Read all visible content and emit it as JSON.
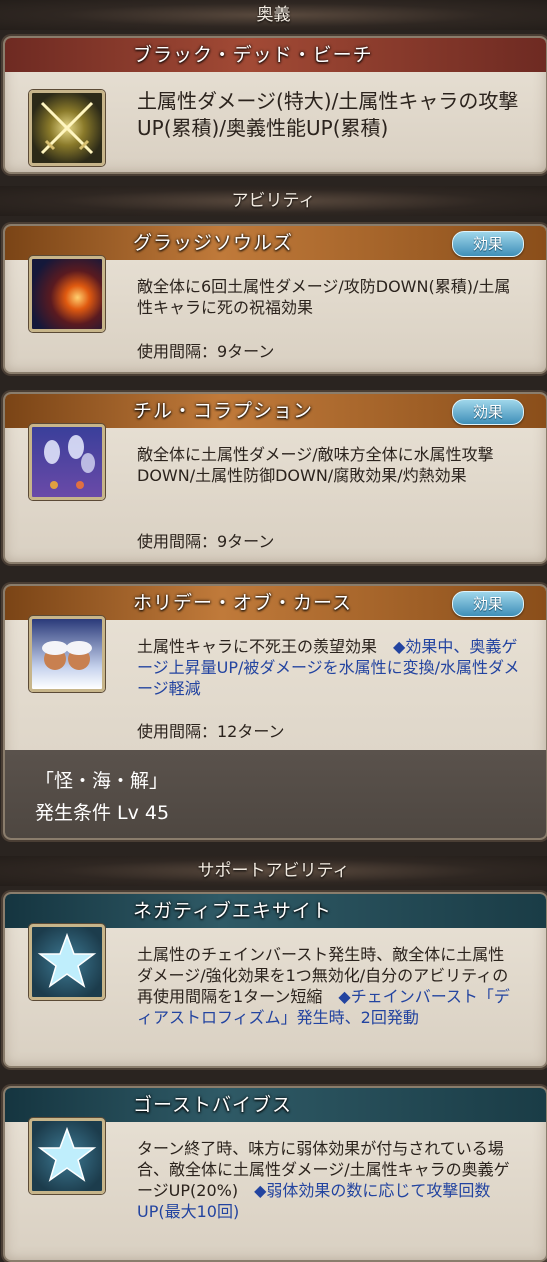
{
  "sections": {
    "ougi": "奥義",
    "ability": "アビリティ",
    "support": "サポートアビリティ"
  },
  "ougi": {
    "name": "ブラック・デッド・ビーチ",
    "desc": "土属性ダメージ(特大)/土属性キャラの攻撃UP(累積)/奥義性能UP(累積)",
    "icon": "crossed-swords-icon"
  },
  "abilities": [
    {
      "name": "グラッジソウルズ",
      "badge": "効果",
      "desc": "敵全体に6回土属性ダメージ/攻防DOWN(累積)/土属性キャラに死の祝福効果",
      "extra": "",
      "interval": "使用間隔：9ターン",
      "icon": "fireball-icon"
    },
    {
      "name": "チル・コラプション",
      "badge": "効果",
      "desc": "敵全体に土属性ダメージ/敵味方全体に水属性攻撃DOWN/土属性防御DOWN/腐敗効果/灼熱効果",
      "extra": "",
      "interval": "使用間隔：9ターン",
      "icon": "ghosts-icon"
    },
    {
      "name": "ホリデー・オブ・カース",
      "badge": "効果",
      "desc": "土属性キャラに不死王の羨望効果",
      "extra": "◆効果中、奥義ゲージ上昇量UP/被ダメージを水属性に変換/水属性ダメージ軽減",
      "interval": "使用間隔：12ターン",
      "icon": "holiday-curse-icon",
      "condition_title": "「怪・海・解」",
      "condition_level": "発生条件 Lv 45"
    }
  ],
  "support": [
    {
      "name": "ネガティブエキサイト",
      "desc": "土属性のチェインバースト発生時、敵全体に土属性ダメージ/強化効果を1つ無効化/自分のアビリティの再使用間隔を1ターン短縮",
      "extra": "◆チェインバースト「ディアストロフィズム」発生時、2回発動",
      "icon": "star-icon"
    },
    {
      "name": "ゴーストバイブス",
      "desc": "ターン終了時、味方に弱体効果が付与されている場合、敵全体に土属性ダメージ/土属性キャラの奥義ゲージUP(20%)",
      "extra": "◆弱体効果の数に応じて攻撃回数UP(最大10回)",
      "icon": "star-icon"
    }
  ]
}
